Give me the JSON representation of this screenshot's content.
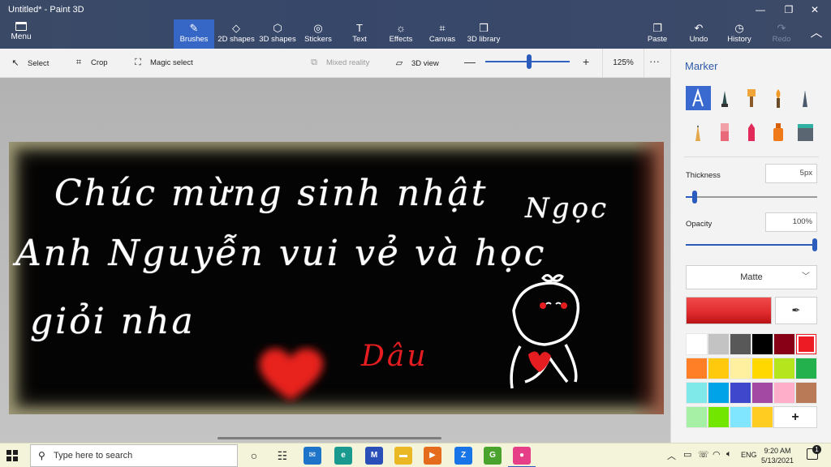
{
  "window": {
    "title": "Untitled* - Paint 3D"
  },
  "menu": {
    "label": "Menu"
  },
  "tools": [
    {
      "label": "Brushes",
      "icon": "brush-icon",
      "glyph": "✎"
    },
    {
      "label": "2D shapes",
      "icon": "2d-shapes-icon",
      "glyph": "◇"
    },
    {
      "label": "3D shapes",
      "icon": "3d-shapes-icon",
      "glyph": "⬡"
    },
    {
      "label": "Stickers",
      "icon": "stickers-icon",
      "glyph": "◎"
    },
    {
      "label": "Text",
      "icon": "text-icon",
      "glyph": "T"
    },
    {
      "label": "Effects",
      "icon": "effects-icon",
      "glyph": "☼"
    },
    {
      "label": "Canvas",
      "icon": "canvas-icon",
      "glyph": "⌗"
    },
    {
      "label": "3D library",
      "icon": "3d-library-icon",
      "glyph": "❒"
    }
  ],
  "actions": [
    {
      "label": "Paste",
      "icon": "paste-icon",
      "glyph": "❐"
    },
    {
      "label": "Undo",
      "icon": "undo-icon",
      "glyph": "↶"
    },
    {
      "label": "History",
      "icon": "history-icon",
      "glyph": "◷"
    },
    {
      "label": "Redo",
      "icon": "redo-icon",
      "glyph": "↷"
    }
  ],
  "subtoolbar": {
    "select": "Select",
    "crop": "Crop",
    "magic_select": "Magic select",
    "mixed_reality": "Mixed reality",
    "view_3d": "3D view",
    "zoom_percent": "125%",
    "zoom_level": 0.52,
    "more": "···"
  },
  "canvas_text": {
    "line1a": "Chúc mừng sinh nhật",
    "line1b": "Ngọc",
    "line2": "Anh Nguyễn vui vẻ và học",
    "line3": "giỏi nha",
    "signature": "Dâu"
  },
  "panel": {
    "title": "Marker",
    "thickness_label": "Thickness",
    "thickness_value": "5px",
    "thickness_level": 0.05,
    "opacity_label": "Opacity",
    "opacity_value": "100%",
    "opacity_level": 1.0,
    "finish": "Matte",
    "current_color": "#e02a2d",
    "brushes": [
      "marker-icon",
      "calligraphy-pen-icon",
      "oil-brush-icon",
      "watercolor-icon",
      "pixel-pen-icon",
      "pencil-icon",
      "eraser-icon",
      "crayon-icon",
      "spray-can-icon",
      "fill-icon"
    ],
    "palette": [
      "#ffffff",
      "#c3c3c3",
      "#585858",
      "#000000",
      "#880015",
      "#ed1c24",
      "#ff7f27",
      "#ffc90e",
      "#fff0a0",
      "#ffd800",
      "#b5e61d",
      "#22b14c",
      "#7fe8e8",
      "#00a2e8",
      "#3f48cc",
      "#a349a4",
      "#ffaec9",
      "#b97a57",
      "#a6f0a6",
      "#73e600",
      "#80e5ff",
      "#ffcc22"
    ],
    "add_color": "+"
  },
  "taskbar": {
    "search_placeholder": "Type here to search",
    "apps": [
      {
        "name": "task-view-icon",
        "glyph": "○",
        "bg": "transparent"
      },
      {
        "name": "widgets-icon",
        "glyph": "☷",
        "bg": "transparent"
      },
      {
        "name": "mail-icon",
        "glyph": "✉",
        "bg": "#1e74c9"
      },
      {
        "name": "edge-icon",
        "glyph": "e",
        "bg": "#1a9a8e"
      },
      {
        "name": "app-blue-icon",
        "glyph": "M",
        "bg": "#2a4fb8"
      },
      {
        "name": "file-explorer-icon",
        "glyph": "▬",
        "bg": "#e9b824"
      },
      {
        "name": "media-player-icon",
        "glyph": "▶",
        "bg": "#e46c1c"
      },
      {
        "name": "zalo-icon",
        "glyph": "Z",
        "bg": "#1875e8"
      },
      {
        "name": "app-green-icon",
        "glyph": "G",
        "bg": "#4aa32d"
      },
      {
        "name": "paint-3d-icon",
        "glyph": "●",
        "bg": "#e63f87"
      }
    ],
    "tray_language": "ENG",
    "time": "9:20 AM",
    "date": "5/13/2021",
    "notifications": "1"
  }
}
